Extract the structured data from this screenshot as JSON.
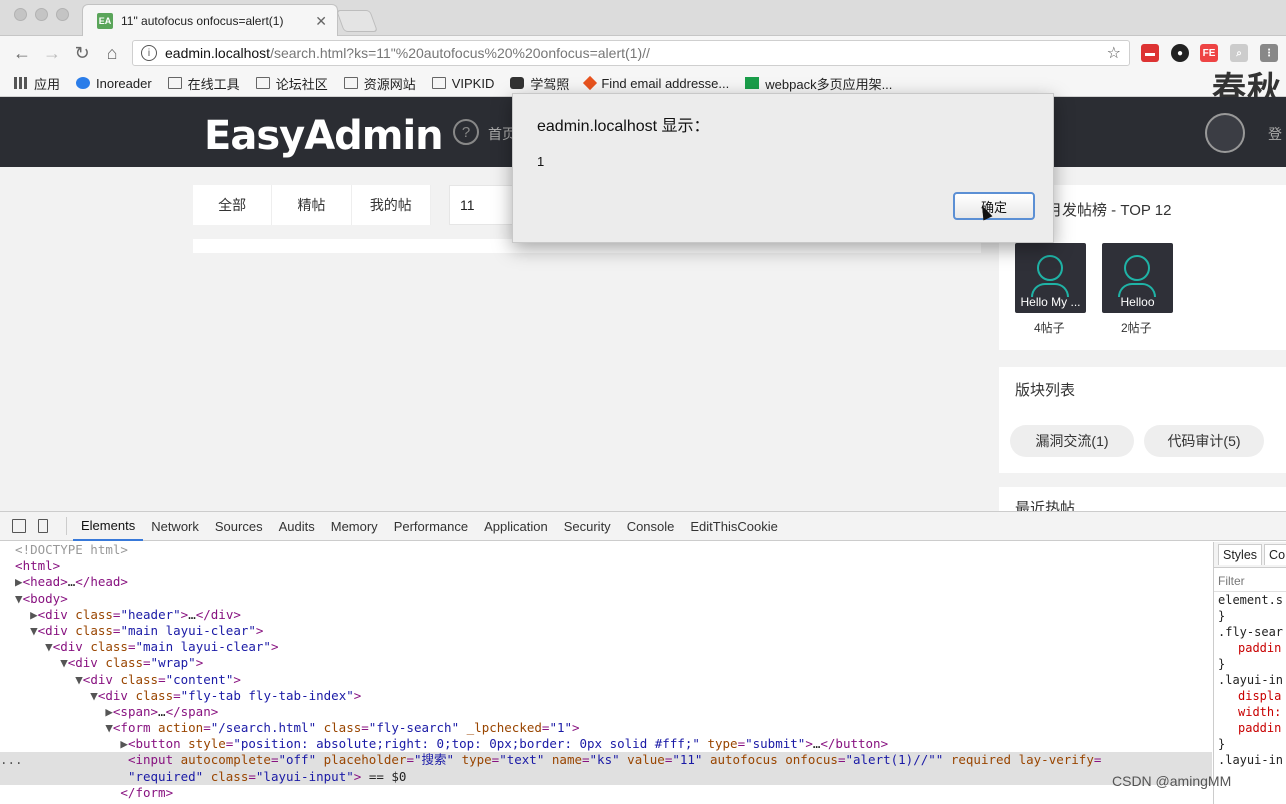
{
  "browser": {
    "tab_title": "11\" autofocus onfocus=alert(1)",
    "tab_favicon": "EA",
    "url_host": "eadmin.localhost",
    "url_path": "/search.html?ks=11\"%20autofocus%20%20onfocus=alert(1)//",
    "bookmarks": [
      "应用",
      "Inoreader",
      "在线工具",
      "论坛社区",
      "资源网站",
      "VIPKID",
      "学驾照",
      "Find email addresse...",
      "webpack多页应用架..."
    ],
    "watermark": "春秋"
  },
  "site": {
    "logo": "EasyAdmin",
    "nav_label": "首页",
    "login_label": "登",
    "tabs": [
      "全部",
      "精帖",
      "我的帖"
    ],
    "search_value": "11",
    "rank_title": "月发帖榜 - TOP 12",
    "users": [
      {
        "name": "Hello My ...",
        "count": "4帖子"
      },
      {
        "name": "Helloo",
        "count": "2帖子"
      }
    ],
    "blocks_title": "版块列表",
    "blocks": [
      "漏洞交流(1)",
      "代码审计(5)"
    ],
    "recent_title": "最近热帖"
  },
  "dialog": {
    "title": "eadmin.localhost 显示：",
    "message": "1",
    "ok": "确定"
  },
  "devtools": {
    "tabs": [
      "Elements",
      "Network",
      "Sources",
      "Audits",
      "Memory",
      "Performance",
      "Application",
      "Security",
      "Console",
      "EditThisCookie"
    ],
    "active_tab": "Elements",
    "styles_tabs": [
      "Styles",
      "Co"
    ],
    "styles_filter": "Filter",
    "styles_lines": [
      "element.s",
      "}",
      ".fly-sear",
      "paddin",
      "}",
      ".layui-in",
      "displa",
      "width:",
      "paddin",
      "}",
      ".layui-in"
    ]
  },
  "credit": "CSDN @amingMM"
}
